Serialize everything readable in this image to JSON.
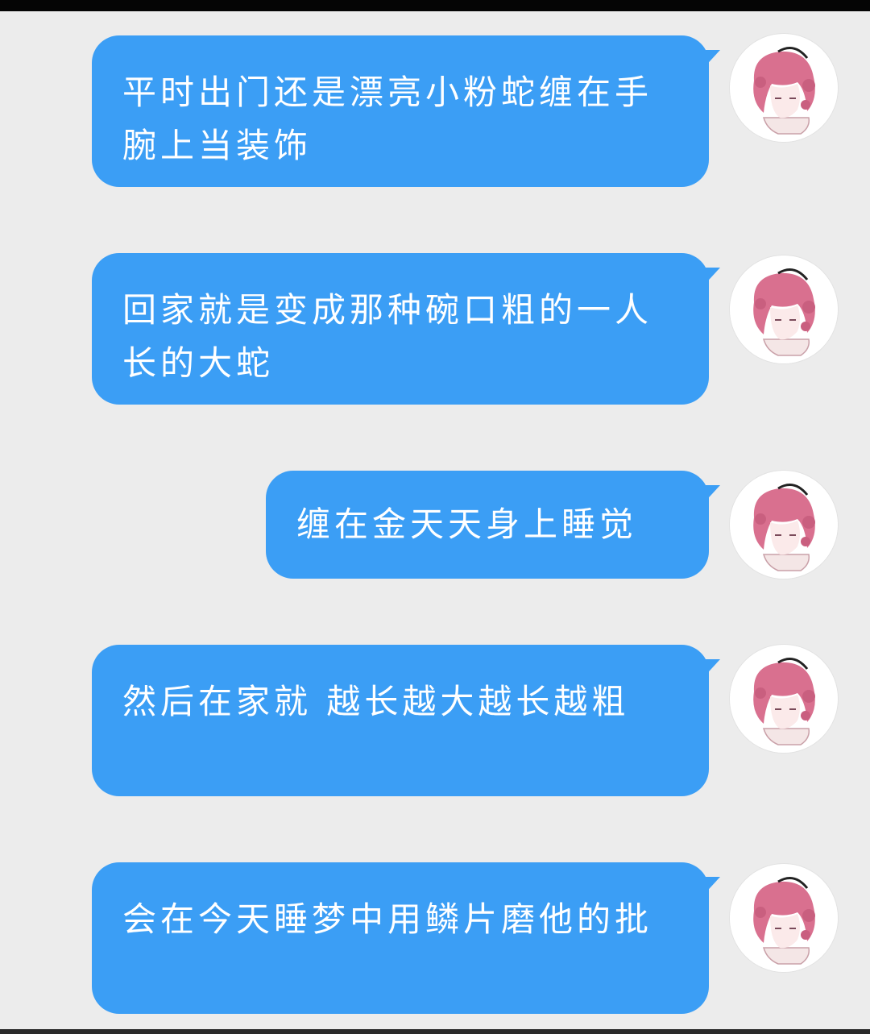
{
  "chat": {
    "messages": [
      {
        "text": "平时出门还是漂亮小粉蛇缠在手腕上当装饰",
        "avatar": "user-avatar-pink-hair"
      },
      {
        "text": "回家就是变成那种碗口粗的一人长的大蛇",
        "avatar": "user-avatar-pink-hair"
      },
      {
        "text": "缠在金天天身上睡觉",
        "avatar": "user-avatar-pink-hair"
      },
      {
        "text": "然后在家就 越长越大越长越粗",
        "avatar": "user-avatar-pink-hair"
      },
      {
        "text": "会在今天睡梦中用鳞片磨他的批",
        "avatar": "user-avatar-pink-hair"
      }
    ]
  },
  "colors": {
    "background": "#ececec",
    "bubble": "#3b9ef5",
    "bubble_text": "#ffffff",
    "avatar_hair": "#d9708f",
    "top_bar": "#050505"
  }
}
